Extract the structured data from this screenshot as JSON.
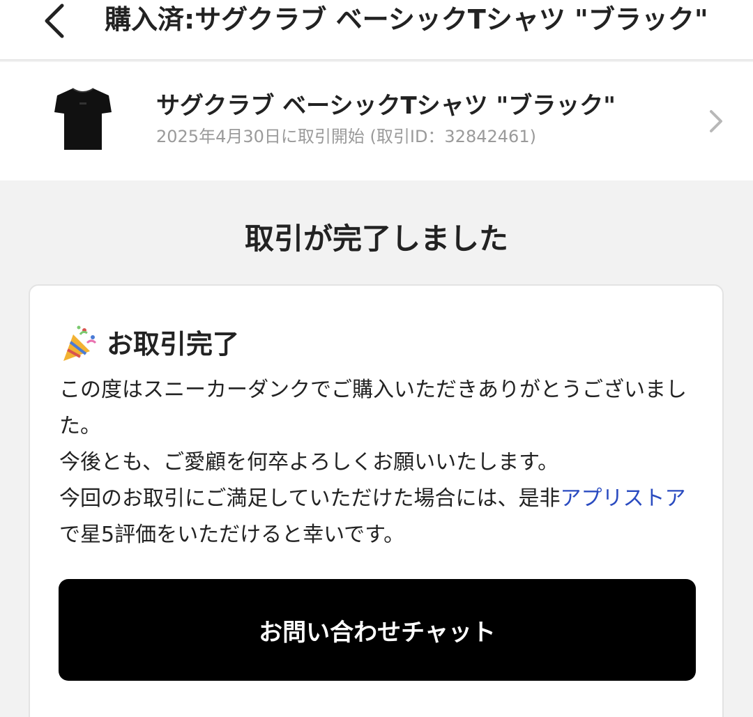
{
  "header": {
    "title": "購入済:サグクラブ ベーシックTシャツ \"ブラック\"",
    "back_icon": "chevron-left-icon"
  },
  "item": {
    "name": "サグクラブ ベーシックTシャツ \"ブラック\"",
    "meta": "2025年4月30日に取引開始 (取引ID：32842461)",
    "thumbnail_icon": "tshirt-icon",
    "chevron_icon": "chevron-right-icon"
  },
  "status": {
    "heading": "取引が完了しました"
  },
  "card": {
    "title_icon": "party-popper-icon",
    "title": "お取引完了",
    "line1": "この度はスニーカーダンクでご購入いただきありがとうございました。",
    "line2": "今後とも、ご愛顧を何卒よろしくお願いいたします。",
    "line3_before_link": "今回のお取引にご満足していただけた場合には、是非",
    "line3_link": "アプリストア",
    "line3_after_link": "で星5評価をいただけると幸いです。",
    "chat_button_label": "お問い合わせチャット"
  },
  "colors": {
    "link": "#2a4bc0",
    "button_bg": "#000000",
    "page_bg": "#f2f2f2"
  }
}
